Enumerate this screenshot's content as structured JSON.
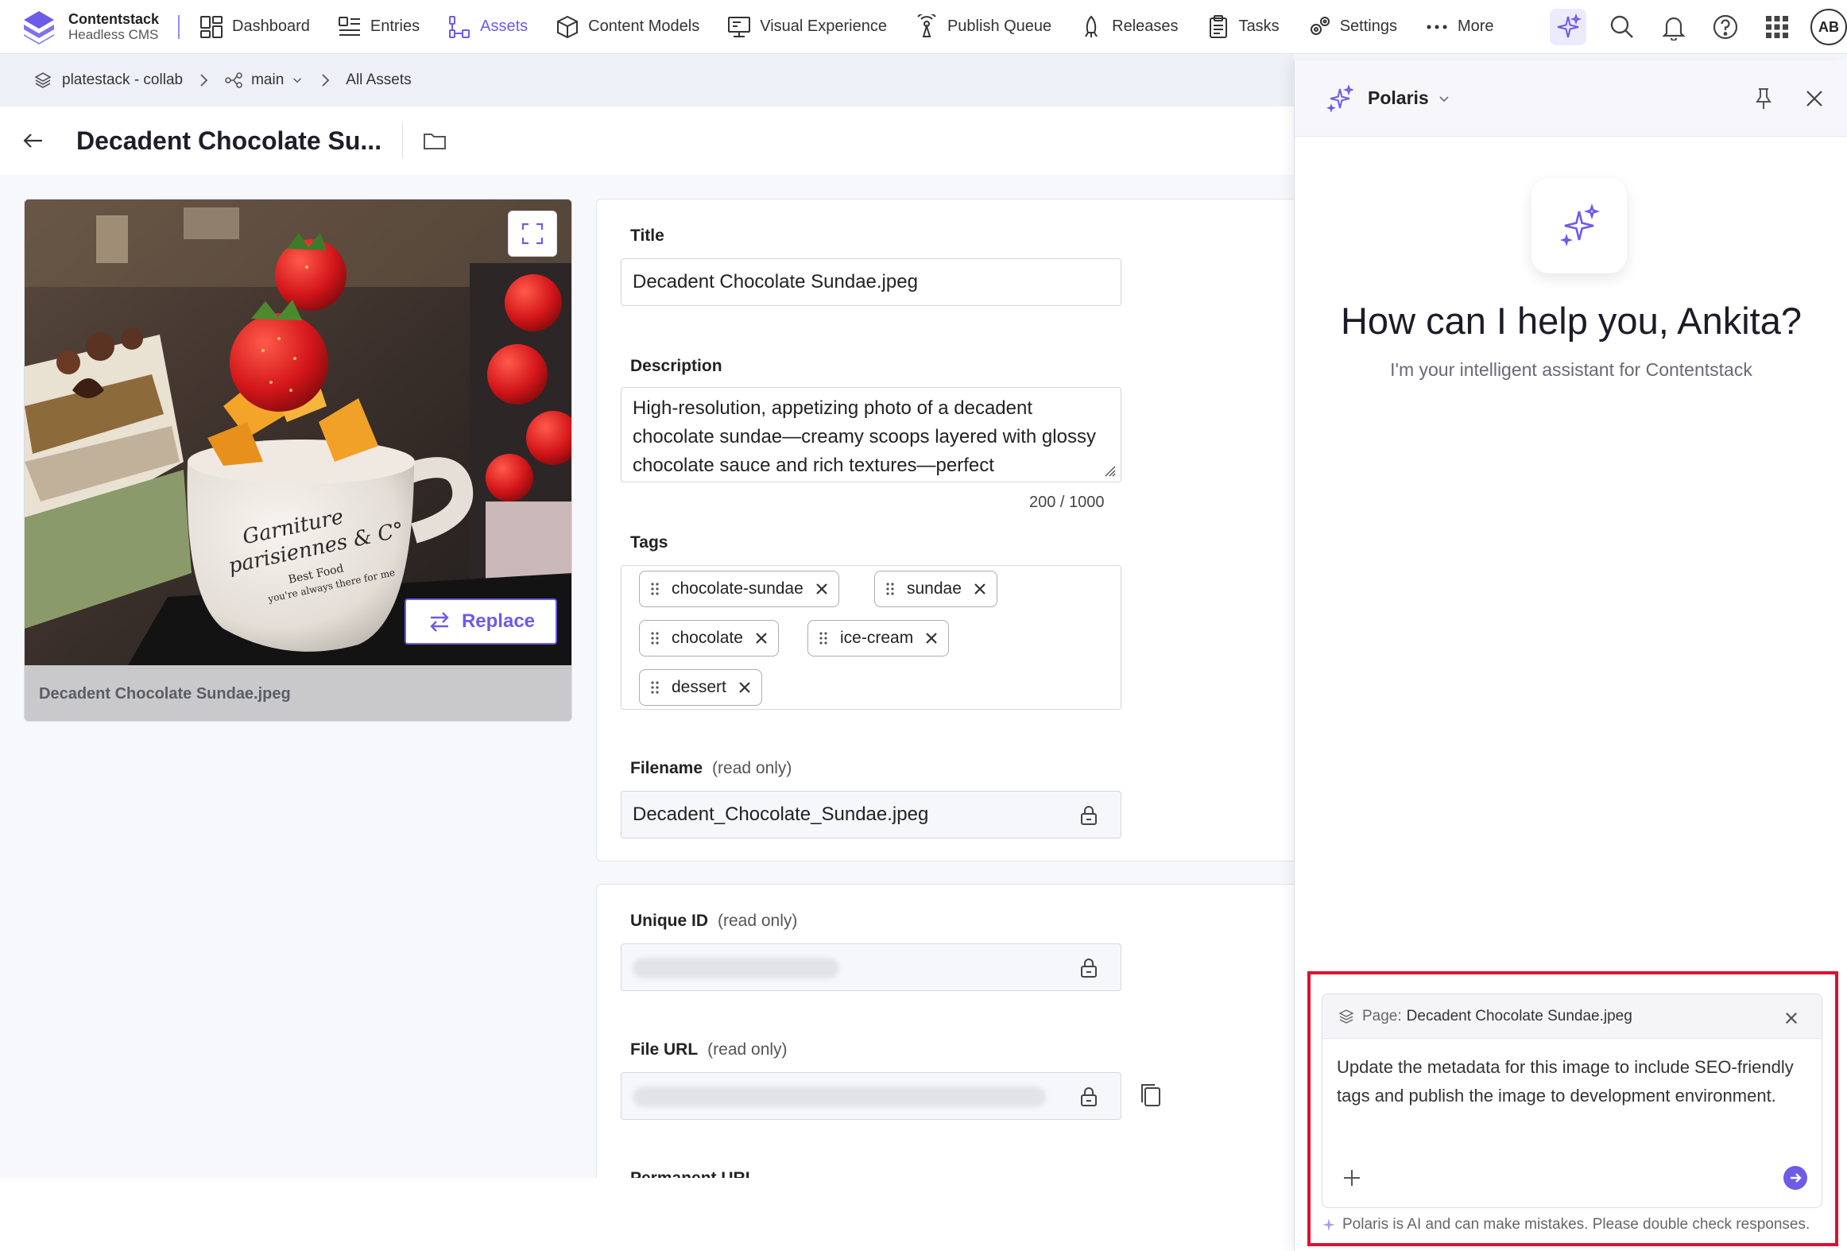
{
  "brand": {
    "name": "Contentstack",
    "sub": "Headless CMS"
  },
  "nav": {
    "items": [
      {
        "label": "Dashboard"
      },
      {
        "label": "Entries"
      },
      {
        "label": "Assets"
      },
      {
        "label": "Content Models"
      },
      {
        "label": "Visual Experience"
      },
      {
        "label": "Publish Queue"
      },
      {
        "label": "Releases"
      },
      {
        "label": "Tasks"
      },
      {
        "label": "Settings"
      },
      {
        "label": "More"
      }
    ],
    "active": "Assets",
    "avatar": "AB"
  },
  "breadcrumb": {
    "stack": "platestack - collab",
    "branch": "main",
    "section": "All Assets"
  },
  "page": {
    "title": "Decadent Chocolate Su..."
  },
  "asset": {
    "caption": "Decadent Chocolate Sundae.jpeg",
    "replace_label": "Replace",
    "mug_text_line1": "Garniture",
    "mug_text_line2": "parisiennes & C°",
    "mug_text_line3": "Best Food",
    "mug_text_line4": "you're always there for me"
  },
  "form": {
    "title_label": "Title",
    "title_value": "Decadent Chocolate Sundae.jpeg",
    "description_label": "Description",
    "description_value": "High-resolution, appetizing photo of a decadent chocolate sundae—creamy scoops layered with glossy chocolate sauce and rich textures—perfect",
    "description_counter": "200 / 1000",
    "tags_label": "Tags",
    "tags": [
      "chocolate-sundae",
      "sundae",
      "chocolate",
      "ice-cream",
      "dessert"
    ],
    "filename_label": "Filename",
    "readonly_note": "(read only)",
    "filename_value": "Decadent_Chocolate_Sundae.jpeg",
    "uid_label": "Unique ID",
    "fileurl_label": "File URL",
    "permanent_label": "Permanent URL"
  },
  "polaris": {
    "title": "Polaris",
    "greeting": "How can I help you, Ankita?",
    "subtitle": "I'm your intelligent assistant for Contentstack",
    "context_prefix": "Page:",
    "context_page": "Decadent Chocolate Sundae.jpeg",
    "prompt": "Update the metadata for this image to include SEO-friendly tags and publish the image to development environment.",
    "disclaimer": "Polaris is AI and can make mistakes. Please double check responses."
  },
  "colors": {
    "accent": "#6c5ce7",
    "highlight": "#e0102e"
  }
}
